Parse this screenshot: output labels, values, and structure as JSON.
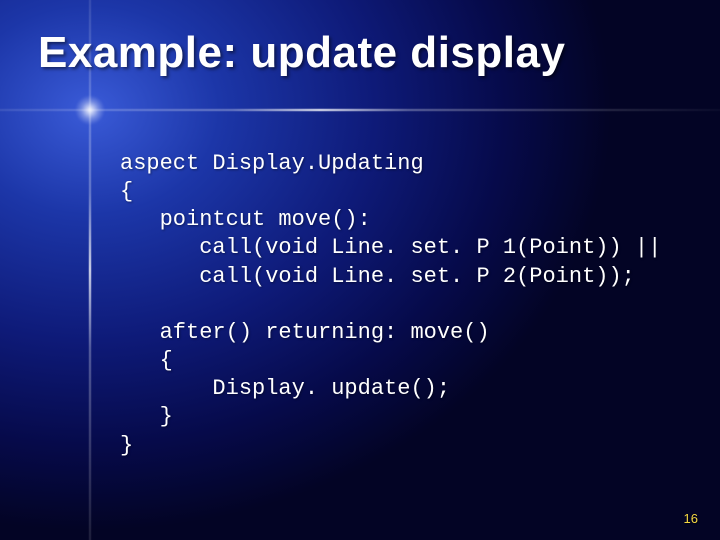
{
  "slide": {
    "title": "Example: update display",
    "page_number": "16",
    "code_lines": [
      "aspect Display.Updating",
      "{",
      "   pointcut move():",
      "      call(void Line. set. P 1(Point)) ||",
      "      call(void Line. set. P 2(Point));",
      "",
      "   after() returning: move()",
      "   {",
      "       Display. update();",
      "   }",
      "}"
    ]
  }
}
